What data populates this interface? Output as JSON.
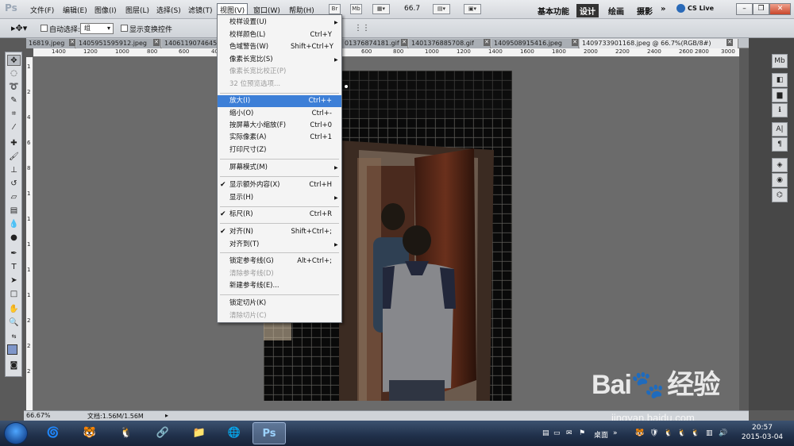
{
  "menubar": {
    "logo": "Ps",
    "items": [
      "文件(F)",
      "编辑(E)",
      "图像(I)",
      "图层(L)",
      "选择(S)",
      "滤镜(T)",
      "视图(V)",
      "窗口(W)",
      "帮助(H)"
    ],
    "mini_buttons": [
      "Br",
      "Mb"
    ],
    "zoom": "66.7",
    "workspaces": [
      "基本功能",
      "设计",
      "绘画",
      "摄影"
    ],
    "active_workspace": "设计",
    "more": "»",
    "cs_live": "CS Live"
  },
  "options": {
    "auto_select_label": "自动选择:",
    "auto_select_value": "组",
    "show_transform_label": "显示变换控件"
  },
  "tabs": [
    "16819.jpeg",
    "1405951595912.jpeg",
    "1406119074645",
    "01376874181.gif",
    "1401376885708.gif",
    "1409508915416.jpeg",
    "1409733901168.jpeg @ 66.7%(RGB/8#)"
  ],
  "ruler": {
    "h_labels": [
      "1400",
      "1200",
      "1000",
      "800",
      "600",
      "400",
      "200",
      "0",
      "200",
      "400",
      "600",
      "800",
      "1000",
      "1200",
      "1400",
      "1600",
      "1800",
      "2000",
      "2200",
      "2400",
      "2600",
      "2800",
      "3000"
    ],
    "v_labels": [
      "1",
      "2",
      "4",
      "6",
      "8",
      "1",
      "1",
      "1",
      "1",
      "1",
      "2",
      "2",
      "2"
    ]
  },
  "view_menu": {
    "items": [
      {
        "label": "校样设置(U)",
        "shortcut": "",
        "submenu": true
      },
      {
        "label": "校样颜色(L)",
        "shortcut": "Ctrl+Y"
      },
      {
        "label": "色域警告(W)",
        "shortcut": "Shift+Ctrl+Y"
      },
      {
        "label": "像素长宽比(S)",
        "shortcut": "",
        "submenu": true
      },
      {
        "label": "像素长宽比校正(P)",
        "shortcut": "",
        "disabled": true
      },
      {
        "label": "32 位预览选项...",
        "shortcut": "",
        "disabled": true
      },
      {
        "label": "放大(I)",
        "shortcut": "Ctrl++",
        "highlighted": true
      },
      {
        "label": "缩小(O)",
        "shortcut": "Ctrl+-"
      },
      {
        "label": "按屏幕大小缩放(F)",
        "shortcut": "Ctrl+0"
      },
      {
        "label": "实际像素(A)",
        "shortcut": "Ctrl+1"
      },
      {
        "label": "打印尺寸(Z)",
        "shortcut": ""
      },
      {
        "label": "屏幕模式(M)",
        "shortcut": "",
        "submenu": true
      },
      {
        "label": "显示额外内容(X)",
        "shortcut": "Ctrl+H",
        "checked": true
      },
      {
        "label": "显示(H)",
        "shortcut": "",
        "submenu": true
      },
      {
        "label": "标尺(R)",
        "shortcut": "Ctrl+R",
        "checked": true
      },
      {
        "label": "对齐(N)",
        "shortcut": "Shift+Ctrl+;",
        "checked": true
      },
      {
        "label": "对齐到(T)",
        "shortcut": "",
        "submenu": true
      },
      {
        "label": "锁定参考线(G)",
        "shortcut": "Alt+Ctrl+;"
      },
      {
        "label": "清除参考线(D)",
        "shortcut": "",
        "disabled": true
      },
      {
        "label": "新建参考线(E)...",
        "shortcut": ""
      },
      {
        "label": "锁定切片(K)",
        "shortcut": ""
      },
      {
        "label": "清除切片(C)",
        "shortcut": "",
        "disabled": true
      }
    ]
  },
  "status": {
    "zoom": "66.67%",
    "doc": "文档:1.56M/1.56M"
  },
  "taskbar": {
    "time": "20:57",
    "date": "2015-03-04",
    "desktop_label": "桌面",
    "ps_label": "Ps"
  },
  "watermark": {
    "brand": "Bai",
    "brand2": "经验",
    "url": "jingyan.baidu.com"
  },
  "colors": {
    "highlight": "#3d7fd7",
    "workspace_active": "#333333"
  }
}
